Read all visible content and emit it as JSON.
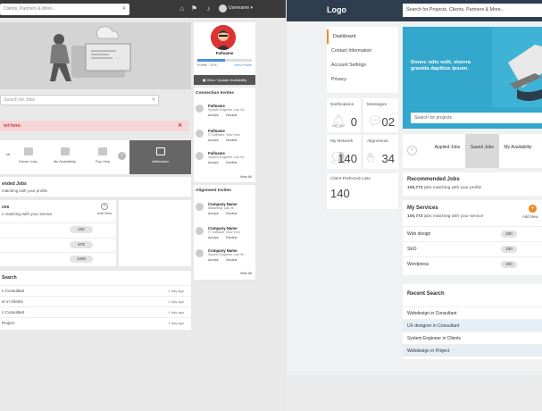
{
  "left": {
    "search_placeholder": "Clients, Partners & More...",
    "username": "Username ▾",
    "search_jobs_placeholder": "Search for Jobs",
    "alert_text": "ort here.",
    "tabs": [
      {
        "label": "ob"
      },
      {
        "label": "Saved Jobs"
      },
      {
        "label": "My Availability"
      },
      {
        "label": "Pay Help"
      },
      {
        "label": "Affirmation"
      }
    ],
    "recommended": {
      "title": "ended Jobs",
      "subtitle": "matching with your profile"
    },
    "services": {
      "title": "ces",
      "subtitle": "s matching with your service",
      "add_label": "Add New",
      "rows": [
        {
          "value": "200"
        },
        {
          "value": "678"
        },
        {
          "value": "1000"
        }
      ]
    },
    "recent": {
      "title": "Search",
      "rows": [
        {
          "label": "n Consultant",
          "date": "1 day ago"
        },
        {
          "label": "er in Clients",
          "date": "1 day ago"
        },
        {
          "label": "n Consultant",
          "date": "1 day ago"
        },
        {
          "label": "Project",
          "date": "1 day ago"
        }
      ]
    },
    "profile": {
      "name": "Fullname",
      "progress": 0.5,
      "progress_label": "Profile - 10% .",
      "view_profile": "View Profile",
      "button": "View / Update Availability"
    },
    "invites": {
      "title": "Connection Invites",
      "items": [
        {
          "name": "Fullname",
          "role": "System Engineer, Las Ve..."
        },
        {
          "name": "Fullname",
          "role": "IT Software, New York"
        },
        {
          "name": "Fullname",
          "role": "System Engineer, Las Ve..."
        }
      ],
      "accept": "Accept",
      "decline": "Decline",
      "view_all": "View All"
    },
    "alignments": {
      "title": "Alignment Invites",
      "items": [
        {
          "name": "Company Name",
          "role": "Marketing, Las Ve..."
        },
        {
          "name": "Company Name",
          "role": "IT Software, New York"
        },
        {
          "name": "Company Name",
          "role": "System Engineer, Las Ve..."
        }
      ],
      "accept": "Accept",
      "decline": "Decline",
      "view_all": "View All"
    }
  },
  "right": {
    "logo": "Logo",
    "search_placeholder": "Search for Projects, Clients, Partners & More...",
    "menu": [
      {
        "label": "Dashboard",
        "active": true
      },
      {
        "label": "Contact Information"
      },
      {
        "label": "Account Settings"
      },
      {
        "label": "Privacy"
      }
    ],
    "hero_text": "Donec odio velit, viverra gravida dapibus ipsum.",
    "hero_search_placeholder": "Search for projects",
    "stats": [
      {
        "label": "Notifications",
        "value": "0"
      },
      {
        "label": "Messages",
        "value": "02"
      },
      {
        "label": "My Network",
        "value": "140"
      },
      {
        "label": "Alignments",
        "value": "34"
      }
    ],
    "client_lists": {
      "label": "Client Preferred Lists",
      "value": "140"
    },
    "tabs": [
      {
        "label": "Applied Jobs"
      },
      {
        "label": "Saved Jobs"
      },
      {
        "label": "My Availability"
      }
    ],
    "recommended": {
      "title": "Recommended Jobs",
      "count": "105,773",
      "subtitle": "jobs matching with your profile"
    },
    "services": {
      "title": "My Services",
      "count": "105,773",
      "subtitle": "jobs matching with your service",
      "add_label": "Add New",
      "rows": [
        {
          "label": "Web design",
          "value": "200"
        },
        {
          "label": "SEO",
          "value": "200"
        },
        {
          "label": "Wordpress",
          "value": "200"
        }
      ]
    },
    "recent": {
      "title": "Recent Search",
      "rows": [
        {
          "label": "Webdesign in Consultant"
        },
        {
          "label": "UX designer in Consultant"
        },
        {
          "label": "System Engineer in Clients"
        },
        {
          "label": "Webdesign in Project"
        }
      ]
    }
  }
}
